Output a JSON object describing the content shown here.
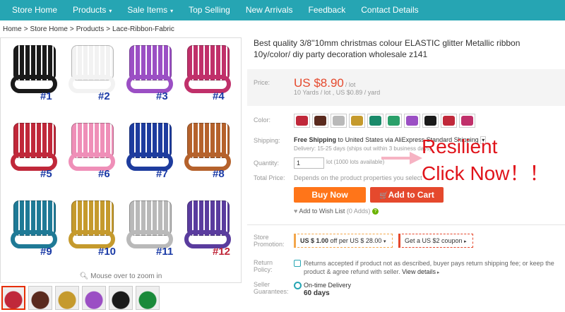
{
  "nav": {
    "items": [
      {
        "label": "Store Home",
        "dropdown": false
      },
      {
        "label": "Products",
        "dropdown": true
      },
      {
        "label": "Sale Items",
        "dropdown": true
      },
      {
        "label": "Top Selling",
        "dropdown": false
      },
      {
        "label": "New Arrivals",
        "dropdown": false
      },
      {
        "label": "Feedback",
        "dropdown": false
      },
      {
        "label": "Contact Details",
        "dropdown": false
      }
    ],
    "caret": "▾",
    "bg_color": "#26a5b3"
  },
  "breadcrumb": [
    "Home",
    ">",
    "Store Home",
    ">",
    "Products",
    ">",
    "Lace-Ribbon-Fabric"
  ],
  "gallery": {
    "labels": [
      "#1",
      "#2",
      "#3",
      "#4",
      "#5",
      "#6",
      "#7",
      "#8",
      "#9",
      "#10",
      "#11",
      "#12"
    ],
    "colors": [
      "#1a1a1a",
      "#f2f2f2",
      "#9b4fc4",
      "#c0306a",
      "#c0283a",
      "#ef8fb8",
      "#1e3c9e",
      "#b5622c",
      "#1f7a96",
      "#c59a2d",
      "#b9b9b9",
      "#5a3c9e"
    ],
    "zoom_hint": "Mouse over to zoom in",
    "thumb_colors": [
      "#c0283a",
      "#5a2a1e",
      "#c59a2d",
      "#9b4fc4",
      "#1a1a1a",
      "#1a8a3a"
    ]
  },
  "product": {
    "title": "Best quality 3/8''10mm christmas colour ELASTIC glitter Metallic ribbon 10y/color/ diy party decoration wholesale z141",
    "price_label": "Price:",
    "price": "US $8.90",
    "price_unit": "/ lot",
    "price_sub": "10 Yards / lot , US $0.89 / yard",
    "color_label": "Color:",
    "swatch_colors": [
      "#c0283a",
      "#5a2a1e",
      "#b9b9b9",
      "#c59a2d",
      "#1a8a6a",
      "#2aa06a",
      "#9b4fc4",
      "#1a1a1a",
      "#c0283a",
      "#c0306a"
    ],
    "shipping_label": "Shipping:",
    "shipping_free": "Free Shipping",
    "shipping_to": "to",
    "shipping_dest": "United States via AliExpress Standard Shipping",
    "shipping_delivery": "Delivery: 15-25 days (ships out within 3 business days)",
    "quantity_label": "Quantity:",
    "quantity_value": "1",
    "quantity_unit": "lot (1000 lots available)",
    "total_label": "Total Price:",
    "total_value": "Depends on the product properties you select",
    "buy_now": "Buy Now",
    "add_to_cart": "Add to Cart",
    "cart_icon": "🛒",
    "wishlist": "Add to Wish List",
    "wishlist_count": "(0 Adds)",
    "help_icon": "?",
    "promotion_label": "Store Promotion:",
    "coupon1_prefix": "US $ 1.00",
    "coupon1_rest": "off per US $ 28.00",
    "coupon2": "Get a US $2 coupon",
    "return_label": "Return Policy:",
    "return_text": "Returns accepted if product not as described, buyer pays return shipping fee; or keep the product & agree refund with seller.",
    "return_link": "View details",
    "guarantee_label": "Seller Guarantees:",
    "guarantee1": "On-time Delivery",
    "guarantee2": "60 days"
  },
  "overlay": {
    "line1": "Resilient",
    "line2": "Click Now！！",
    "color": "#e0131a"
  }
}
